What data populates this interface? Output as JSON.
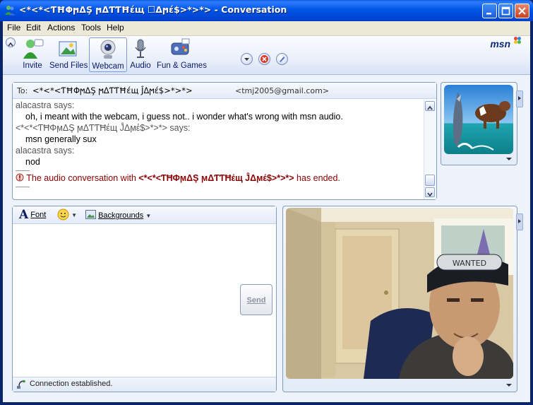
{
  "window": {
    "title": "<*<*<ƬĦΦϻΔŞ ϻΔƬƬĦέщ ☐Δϻέ$>*>*> - Conversation"
  },
  "menu": [
    {
      "label": "File"
    },
    {
      "label": "Edit"
    },
    {
      "label": "Actions"
    },
    {
      "label": "Tools"
    },
    {
      "label": "Help"
    }
  ],
  "toolbar": {
    "buttons": [
      {
        "label": "Invite",
        "icon": "invite-icon"
      },
      {
        "label": "Send Files",
        "icon": "send-files-icon"
      },
      {
        "label": "Webcam",
        "icon": "webcam-icon",
        "active": true
      },
      {
        "label": "Audio",
        "icon": "audio-icon"
      },
      {
        "label": "Fun & Games",
        "icon": "fun-games-icon"
      }
    ],
    "brand": "msn"
  },
  "conversation": {
    "to_label": "To:",
    "to_name": "<*<*<ƬĦΦϻΔŞ ϻΔƬƬĦέщ ĴΔϻέ$>*>*>",
    "to_email": "<tmj2005@gmail.com>",
    "messages": [
      {
        "sender": "alacastra says:",
        "lines": [
          "oh, i meant with the webcam, i guess not..  i wonder what's wrong with msn audio."
        ]
      },
      {
        "sender": "<*<*<ƬĦΦϻΔŞ ϻΔƬƬĦέщ ĴΔϻέ$>*>*> says:",
        "lines": [
          "msn generally sux"
        ]
      },
      {
        "sender": "alacastra says:",
        "lines": [
          "nod"
        ]
      }
    ],
    "system_pre": "The audio conversation with ",
    "system_name": "<*<*<ƬĦΦϻΔŞ ϻΔƬƬĦέщ ĴΔϻέ$>*>*>",
    "system_post": " has ended."
  },
  "compose": {
    "font_label": "Font",
    "backgrounds_label": "Backgrounds",
    "send_label": "Send",
    "input_value": ""
  },
  "status": {
    "text": "Connection established."
  },
  "colors": {
    "title_blue": "#0055e5",
    "system_message": "#8b0000",
    "panel_border": "#7f9db9"
  }
}
